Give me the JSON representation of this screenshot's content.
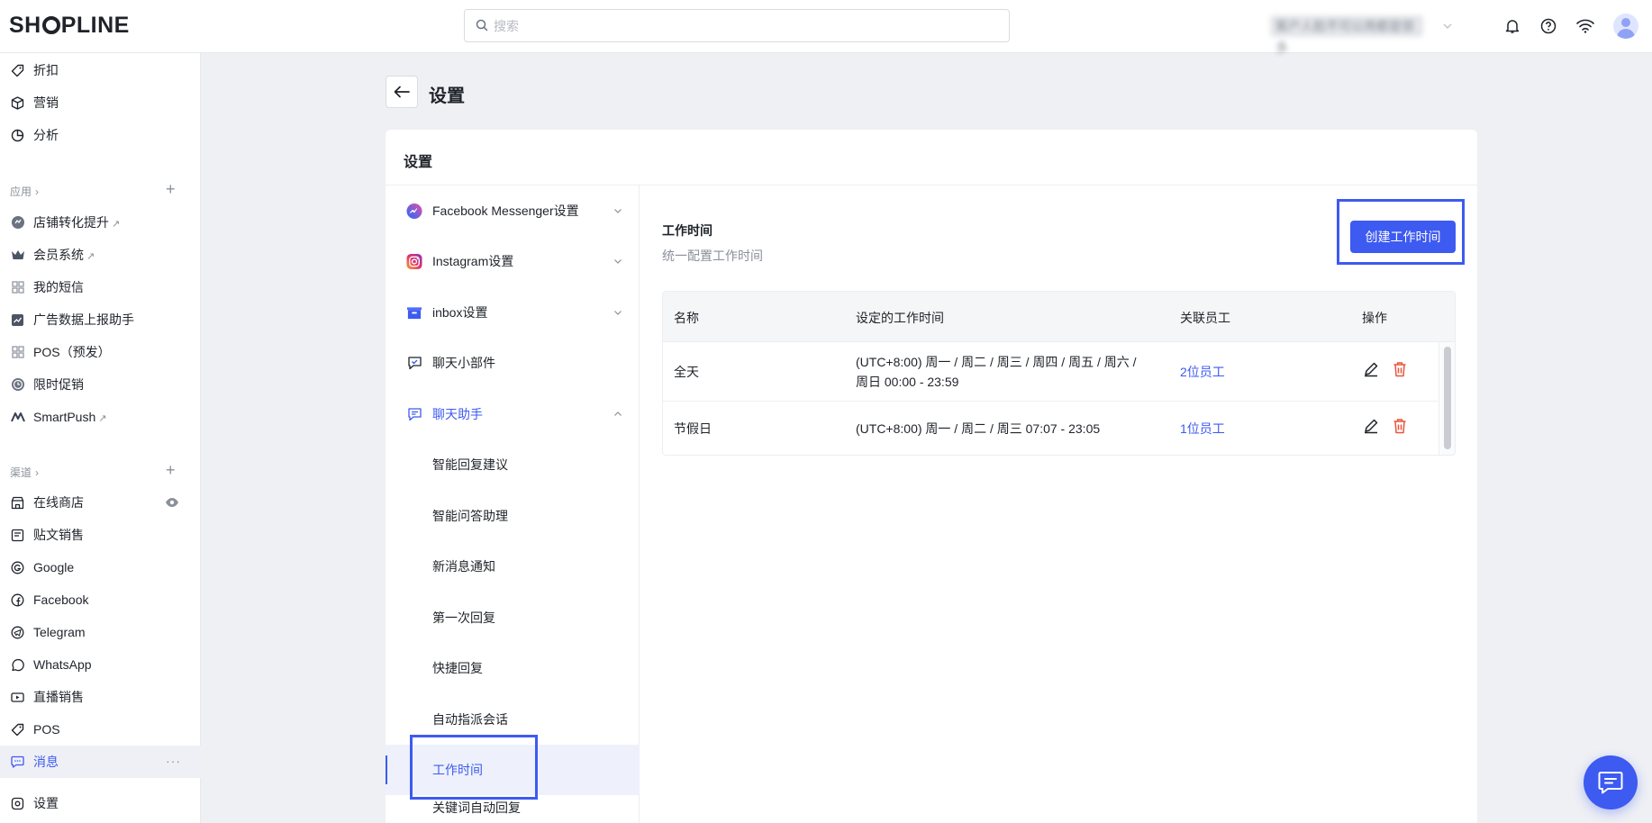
{
  "header": {
    "logo": "SHOPLINE",
    "search_placeholder": "搜索",
    "store_name": "客户人脸不可以用都是很多"
  },
  "sidebar": {
    "top_items": [
      {
        "label": "折扣",
        "icon": "tag-icon"
      },
      {
        "label": "营销",
        "icon": "cube-icon"
      },
      {
        "label": "分析",
        "icon": "pie-chart-icon"
      }
    ],
    "apps_header": "应用",
    "apps": [
      {
        "label": "店铺转化提升",
        "icon": "conversion-icon",
        "external": true
      },
      {
        "label": "会员系统",
        "icon": "crown-icon",
        "external": true
      },
      {
        "label": "我的短信",
        "icon": "grid-icon",
        "external": false
      },
      {
        "label": "广告数据上报助手",
        "icon": "chart-icon",
        "external": false
      },
      {
        "label": "POS（预发）",
        "icon": "grid-icon",
        "external": false
      },
      {
        "label": "限时促销",
        "icon": "clock-icon",
        "external": false
      },
      {
        "label": "SmartPush",
        "icon": "smartpush-icon",
        "external": true
      }
    ],
    "channels_header": "渠道",
    "channels": [
      {
        "label": "在线商店",
        "icon": "store-icon"
      },
      {
        "label": "贴文销售",
        "icon": "post-icon"
      },
      {
        "label": "Google",
        "icon": "google-icon"
      },
      {
        "label": "Facebook",
        "icon": "facebook-icon"
      },
      {
        "label": "Telegram",
        "icon": "telegram-icon"
      },
      {
        "label": "WhatsApp",
        "icon": "whatsapp-icon"
      },
      {
        "label": "直播销售",
        "icon": "video-icon"
      },
      {
        "label": "POS",
        "icon": "pos-icon"
      },
      {
        "label": "消息",
        "icon": "message-icon"
      }
    ],
    "settings": "设置",
    "external_mark": "↗"
  },
  "page": {
    "title": "设置",
    "card_title": "设置"
  },
  "settings_nav": {
    "items": [
      {
        "label": "Facebook Messenger设置",
        "icon": "messenger-icon",
        "expandable": true
      },
      {
        "label": "Instagram设置",
        "icon": "instagram-icon",
        "expandable": true
      },
      {
        "label": "inbox设置",
        "icon": "inbox-icon",
        "expandable": true
      },
      {
        "label": "聊天小部件",
        "icon": "widget-icon",
        "expandable": false
      },
      {
        "label": "聊天助手",
        "icon": "assistant-icon",
        "expandable": true,
        "expanded": true
      }
    ],
    "sub_items": [
      {
        "label": "智能回复建议"
      },
      {
        "label": "智能问答助理"
      },
      {
        "label": "新消息通知"
      },
      {
        "label": "第一次回复"
      },
      {
        "label": "快捷回复"
      },
      {
        "label": "自动指派会话"
      },
      {
        "label": "工作时间",
        "selected": true
      },
      {
        "label": "关键词自动回复"
      }
    ]
  },
  "work_hours": {
    "title": "工作时间",
    "description": "统一配置工作时间",
    "create_button": "创建工作时间",
    "columns": [
      "名称",
      "设定的工作时间",
      "关联员工",
      "操作"
    ],
    "rows": [
      {
        "name": "全天",
        "time_line1": "(UTC+8:00) 周一 / 周二 / 周三 / 周四 / 周五 / 周六 /",
        "time_line2": "周日 00:00 - 23:59",
        "staff": "2位员工"
      },
      {
        "name": "节假日",
        "time_line1": "(UTC+8:00) 周一 / 周二 / 周三 07:07 - 23:05",
        "time_line2": "",
        "staff": "1位员工"
      }
    ]
  },
  "colors": {
    "accent": "#3d5af1",
    "delete": "#e8553d",
    "muted": "#8a9099"
  }
}
